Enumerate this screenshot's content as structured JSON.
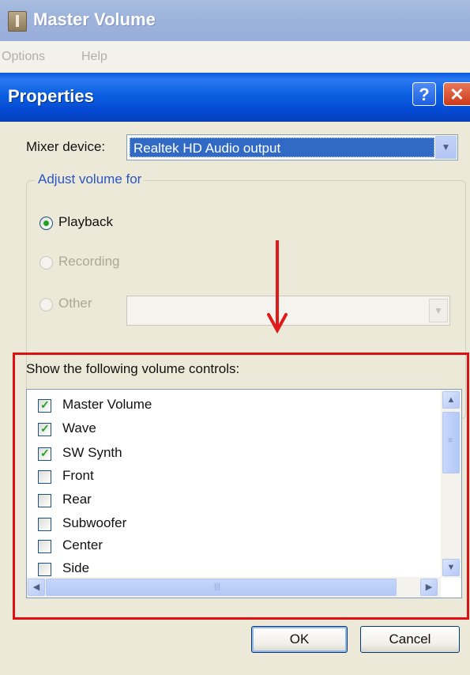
{
  "background_window": {
    "title": "Master Volume",
    "icon": "speaker-app-icon",
    "menu": [
      "Options",
      "Help"
    ]
  },
  "dialog": {
    "title": "Properties",
    "help_glyph": "?",
    "close_glyph": "✕",
    "mixer_label": "Mixer device:",
    "mixer_value": "Realtek HD Audio output",
    "group_title": "Adjust volume for",
    "radios": [
      {
        "label": "Playback",
        "checked": true,
        "enabled": true
      },
      {
        "label": "Recording",
        "checked": false,
        "enabled": false
      },
      {
        "label": "Other",
        "checked": false,
        "enabled": false
      }
    ],
    "controls_label": "Show the following volume controls:",
    "controls": [
      {
        "label": "Master Volume",
        "checked": true
      },
      {
        "label": "Wave",
        "checked": true
      },
      {
        "label": "SW Synth",
        "checked": true
      },
      {
        "label": "Front",
        "checked": false
      },
      {
        "label": "Rear",
        "checked": false
      },
      {
        "label": "Subwoofer",
        "checked": false
      },
      {
        "label": "Center",
        "checked": false
      },
      {
        "label": "Side",
        "checked": false
      }
    ],
    "ok_label": "OK",
    "cancel_label": "Cancel"
  },
  "colors": {
    "annotation_red": "#e01919",
    "selection_blue": "#316ac5",
    "title_blue": "#0548d2"
  }
}
